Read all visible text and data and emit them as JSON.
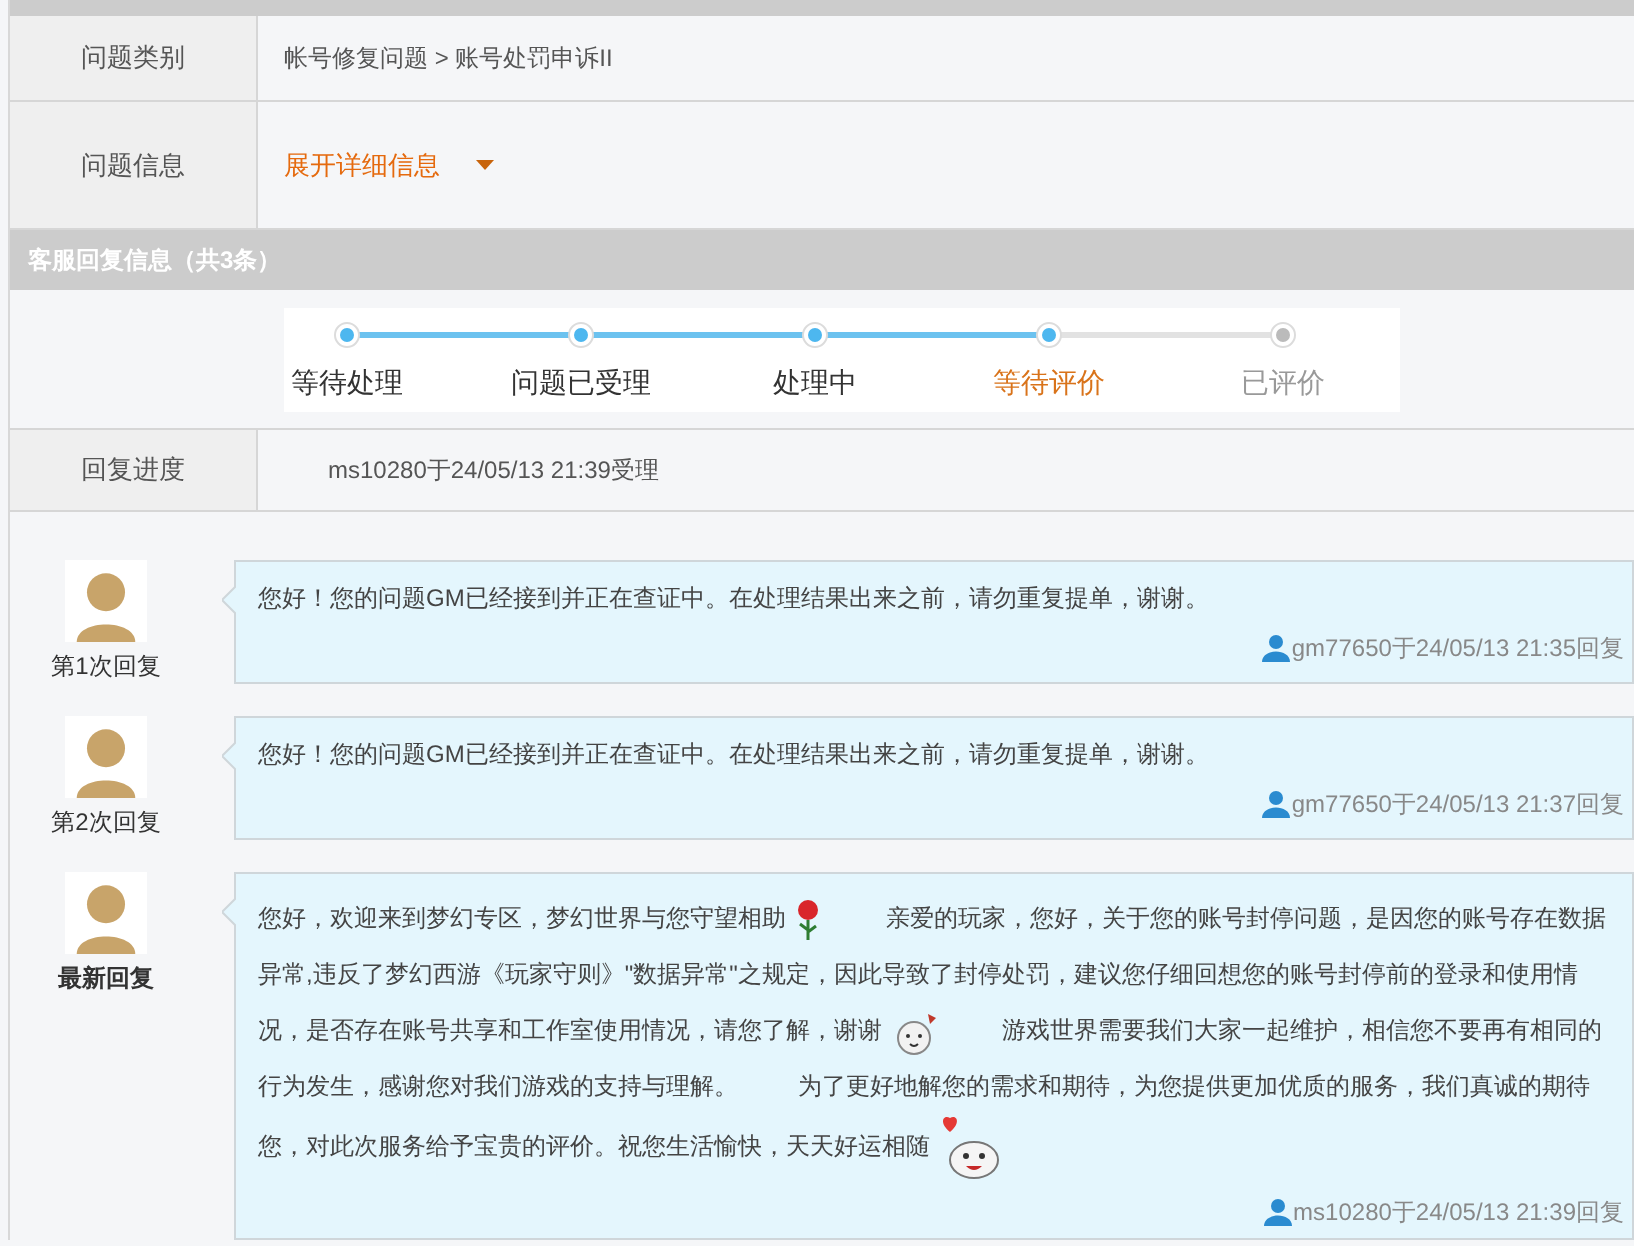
{
  "info_rows": [
    {
      "label": "问题类别",
      "value": "帐号修复问题 > 账号处罚申诉II",
      "kind": "text"
    },
    {
      "label": "问题信息",
      "value": "展开详细信息",
      "kind": "expand"
    }
  ],
  "reply_section": {
    "title": "客服回复信息（共3条）"
  },
  "progress_steps": [
    {
      "label": "等待处理",
      "reached": true,
      "current": false
    },
    {
      "label": "问题已受理",
      "reached": true,
      "current": false
    },
    {
      "label": "处理中",
      "reached": true,
      "current": false
    },
    {
      "label": "等待评价",
      "reached": true,
      "current": true
    },
    {
      "label": "已评价",
      "reached": false,
      "current": false
    }
  ],
  "progress_row": {
    "label": "回复进度",
    "value": "ms10280于24/05/13 21:39受理"
  },
  "replies": [
    {
      "caption": "第1次回复",
      "latest": false,
      "segments": [
        {
          "kind": "text",
          "text": "您好！您的问题GM已经接到并正在查证中。在处理结果出来之前，请勿重复提单，谢谢。"
        }
      ],
      "meta": "gm77650于24/05/13 21:35回复"
    },
    {
      "caption": "第2次回复",
      "latest": false,
      "segments": [
        {
          "kind": "text",
          "text": "您好！您的问题GM已经接到并正在查证中。在处理结果出来之前，请勿重复提单，谢谢。"
        }
      ],
      "meta": "gm77650于24/05/13 21:37回复"
    },
    {
      "caption": "最新回复",
      "latest": true,
      "segments": [
        {
          "kind": "text",
          "text": "您好，欢迎来到梦幻专区，梦幻世界与您守望相助"
        },
        {
          "kind": "flower"
        },
        {
          "kind": "text",
          "text": "亲爱的玩家，您好，关于您的账号封停问题，是因您的账号存在数据异常,违反了梦幻西游《玩家守则》\"数据异常\"之规定，因此导致了封停处罚，建议您仔细回想您的账号封停前的登录和使用情况，是否存在账号共享和工作室使用情况，请您了解，谢谢"
        },
        {
          "kind": "face"
        },
        {
          "kind": "text",
          "text": "游戏世界需要我们大家一起维护，相信您不要再有相同的行为发生，感谢您对我们游戏的支持与理解。"
        },
        {
          "kind": "spacer"
        },
        {
          "kind": "text",
          "text": "为了更好地解您的需求和期待，为您提供更加优质的服务，我们真诚的期待您，对此次服务给予宝贵的评价。祝您生活愉快，天天好运相随"
        },
        {
          "kind": "heart-face"
        }
      ],
      "meta": "ms10280于24/05/13 21:39回复"
    }
  ]
}
